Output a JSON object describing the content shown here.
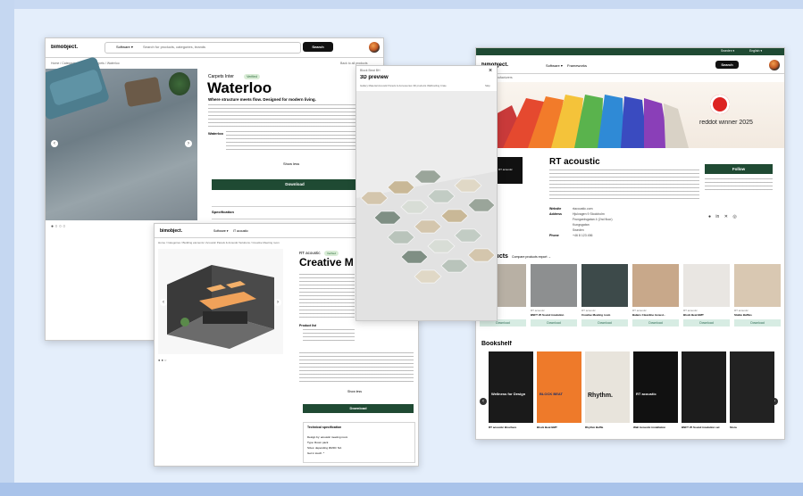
{
  "brand": "bimobject.",
  "colors": {
    "accent_green": "#1f4a33",
    "pill_green": "#d9ecd6",
    "frame_blue": "#a9c3ea"
  },
  "win1": {
    "search_scope": "Software ▾",
    "search_placeholder": "Search for products, categories, brands",
    "search_button": "Search",
    "breadcrumb": "Home / Categories / Flooring / Carpets / Waterloo",
    "back_link": "Back to all products",
    "product_brand": "Carpets Inter",
    "brand_badge": "Verified",
    "product_title": "Waterloo",
    "product_subtitle": "Where structure meets flow. Designed for modern living.",
    "highlight_word": "Waterloo",
    "show_more": "Show less",
    "download_button": "Download",
    "spec_heading": "Specification"
  },
  "win2": {
    "breadcrumb": "Home / Categories / Building elements / Acoustic Panels & Acoustic Solutions / Creative Meeting room",
    "nav_software": "Software ▾",
    "nav_brands": "IT acoustic",
    "product_brand": "RT acoustic",
    "brand_badge": "Verified",
    "product_title": "Creative Meeting room",
    "product_label": "Product list",
    "show_more": "Show less",
    "download_button": "Download",
    "tech_heading": "Technical specification",
    "spec_rows": [
      "Design by: acoustic meeting room",
      "Type: Room pack",
      "Sizes: depending 3D/2D: NA",
      "Get in touch: *"
    ]
  },
  "win3": {
    "header_small": "Block Beat BH",
    "title": "3D preview",
    "close": "×",
    "toolbar": "Gallery  Material  Acoustic Panels & Accessories  3D products  Wall/ceiling  Crate",
    "toolbar_right": "Skip"
  },
  "win4": {
    "top_region": "Sweden ▾",
    "top_lang": "English ▾",
    "nav_software": "Software ▾",
    "nav_frameworks": "Frameworks",
    "search_button": "Search",
    "breadcrumb": "Home / Manufacturers",
    "award_text": "reddot winner 2025",
    "company_name": "RT acoustic",
    "company_logo_text": "RT acoustic",
    "follow_button": "Follow",
    "contact_labels": [
      "Website",
      "Address",
      "",
      "",
      "",
      "Phone"
    ],
    "contact_values": [
      "rtacoustic.com",
      "Hjulvagen 9 Stockholm",
      "Frungardsgatan 4 (2nd floor)",
      "Kungsgatan",
      "Sweden",
      "+46 8 123 456"
    ],
    "products_heading": "products",
    "products_link": "Compare products export  →",
    "products": [
      {
        "brand": "RT acoustic",
        "name": "Ellis",
        "button": "Download"
      },
      {
        "brand": "RT acoustic",
        "name": "BNFT 25 Sound insulation",
        "button": "Download"
      },
      {
        "brand": "RT acoustic",
        "name": "Creative Meeting room",
        "button": "Download"
      },
      {
        "brand": "RT acoustic",
        "name": "Balans Cleanline Acoust..",
        "button": "Download"
      },
      {
        "brand": "RT acoustic",
        "name": "Block Beat BMT",
        "button": "Download"
      },
      {
        "brand": "RT acoustic",
        "name": "Stable Baffles",
        "button": "Download"
      }
    ],
    "bookshelf_heading": "Bookshelf",
    "books": [
      {
        "cover_title": "Wellness for Design",
        "caption": "RT acoustic Brochure"
      },
      {
        "cover_title": "BLOCK BEAT",
        "caption": "Block Beat BMT"
      },
      {
        "cover_title": "Rhythm.",
        "caption": "Rhythm Baffle"
      },
      {
        "cover_title": "RT acoustic",
        "caption": "Wall Acoustic installation"
      },
      {
        "cover_title": "",
        "caption": "BNFT 25 Sound insulation set"
      },
      {
        "cover_title": "",
        "caption": "Stora"
      }
    ]
  }
}
